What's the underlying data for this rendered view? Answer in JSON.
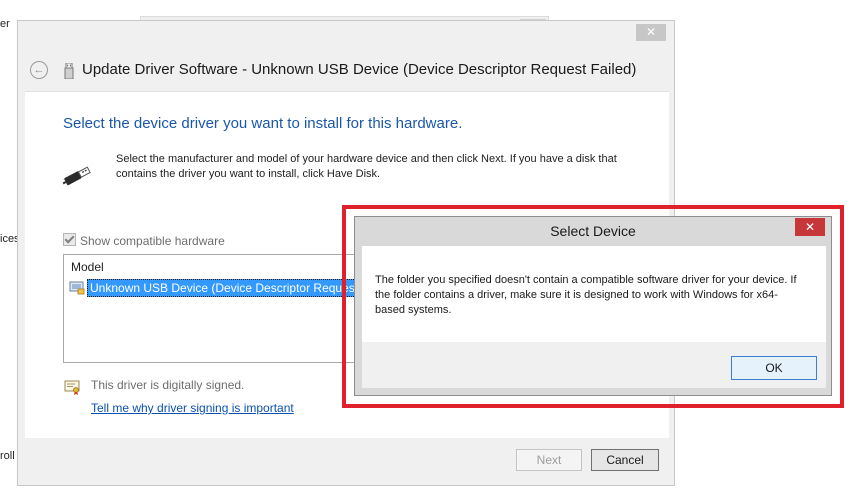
{
  "background": {
    "fragments": [
      "er",
      "ices",
      "roll"
    ]
  },
  "wizard": {
    "title": "Update Driver Software - Unknown USB Device (Device Descriptor Request Failed)",
    "close_glyph": "✕",
    "back_glyph": "←",
    "heading": "Select the device driver you want to install for this hardware.",
    "description": "Select the manufacturer and model of your hardware device and then click Next. If you have a disk that contains the driver you want to install, click Have Disk.",
    "show_compatible_label": "Show compatible hardware",
    "model_header": "Model",
    "model_items": [
      "Unknown USB Device (Device Descriptor Request F"
    ],
    "signed_text": "This driver is digitally signed.",
    "signing_link": "Tell me why driver signing is important",
    "next_label": "Next",
    "cancel_label": "Cancel"
  },
  "dialog": {
    "title": "Select Device",
    "close_glyph": "✕",
    "message": "The folder you specified doesn't contain a compatible software driver for your device. If the folder contains a driver, make sure it is designed to work with Windows for x64-based systems.",
    "ok_label": "OK"
  },
  "colors": {
    "heading_blue": "#1a57a8",
    "selection_blue": "#3399ff",
    "highlight_red": "#e0202b",
    "close_red": "#c7373a"
  }
}
